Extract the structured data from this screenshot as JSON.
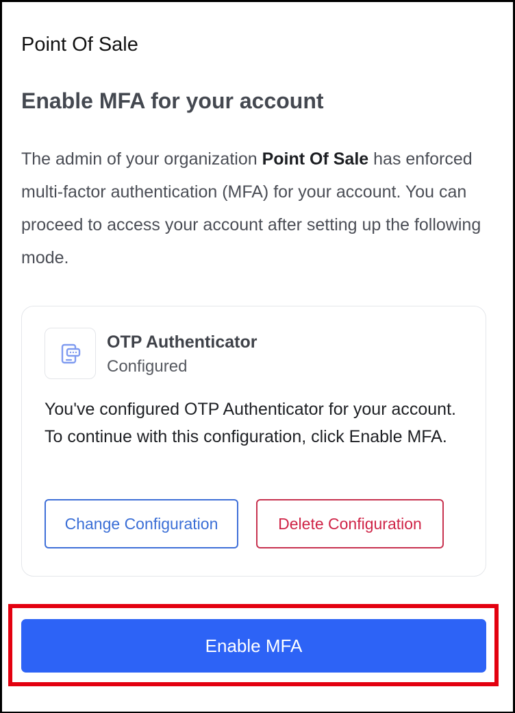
{
  "organization": {
    "name": "Point Of Sale"
  },
  "page": {
    "heading": "Enable MFA for your account",
    "intro_before": "The admin of your organization ",
    "intro_org": "Point Of Sale",
    "intro_after": " has enforced multi-factor authentication (MFA) for your account. You can proceed to access your account after setting up the following mode."
  },
  "mode_card": {
    "icon": "otp-authenticator-icon",
    "title": "OTP Authenticator",
    "status": "Configured",
    "description": "You've configured OTP Authenticator for your account. To continue with this configuration, click Enable MFA.",
    "change_label": "Change Configuration",
    "delete_label": "Delete Configuration"
  },
  "primary_action": {
    "label": "Enable MFA"
  },
  "colors": {
    "primary": "#2d63f6",
    "link_blue": "#3a6ed6",
    "danger": "#cf2447",
    "highlight": "#e3000f",
    "icon_blue": "#7e9af0"
  }
}
